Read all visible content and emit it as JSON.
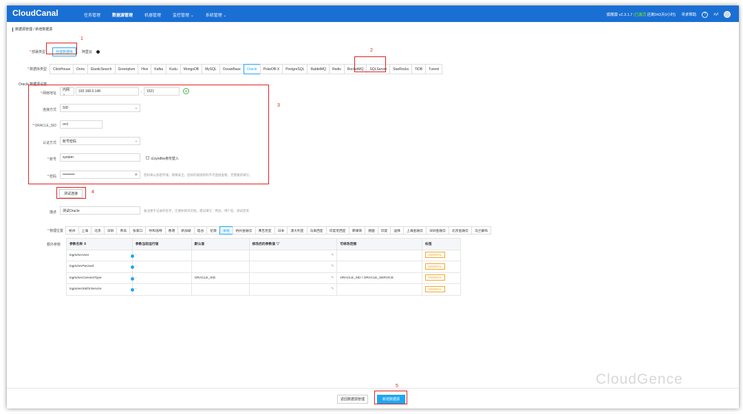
{
  "header": {
    "logo": "CloudCanal",
    "nav": [
      "任务管理",
      "数据源管理",
      "机器管理",
      "监控管理 ⌄",
      "系统管理 ⌄"
    ],
    "version": "旗舰版 v2.3.1.7",
    "status": "(已激活",
    "trial": "还剩343天0小时)",
    "help": "寻求帮助",
    "help_icon": "?",
    "user": "zyl"
  },
  "breadcrumb": [
    "数据源管理",
    "新增数据源"
  ],
  "form": {
    "deploy_label": "部署类型",
    "deploy_options": [
      "自建数据库",
      "阿里云"
    ],
    "dbtype_label": "数据库类型",
    "db_types": [
      "ClickHouse",
      "Doris",
      "ElasticSearch",
      "Greenplum",
      "Hive",
      "Kafka",
      "Kudu",
      "MongoDB",
      "MySQL",
      "OceanBase",
      "Oracle",
      "PolarDB-X",
      "PostgreSQL",
      "RabbitMQ",
      "Redis",
      "RocketMQ",
      "SQLServer",
      "StarRocks",
      "TiDB",
      "Tunnel"
    ],
    "selected_db": "Oracle",
    "section_title": "Oracle 数据源设置",
    "network_label": "网络地址",
    "network_type": "内网 ⌄",
    "host": "192.168.0.148",
    "port": "1521",
    "conn_label": "连接方式",
    "conn_value": "SID",
    "sid_label": "ORACLE_SID",
    "sid_value": "orcl",
    "auth_label": "认证方式",
    "auth_value": "账号密码",
    "account_label": "账号",
    "account_value": "system",
    "sysdba": "以sysdba身份登入",
    "password_label": "密码",
    "password_value": "••••••••••",
    "password_hint": "密码将以加密存储，保障安全。后续的链接新的不可直接查看，无需重新填写。",
    "test_btn": "测试连接",
    "desc_label": "描述",
    "desc_value": "测试Oracle",
    "desc_hint": "备注便于记录的名字，方便你辨识识别。建议填写：用途、用户名、测试还等",
    "region_label": "物理位置",
    "regions": [
      "杭州",
      "上海",
      "北京",
      "深圳",
      "青岛",
      "张家口",
      "呼和浩特",
      "香港",
      "新加坡",
      "硅谷",
      "伦敦",
      "本地",
      "杭州金融云",
      "弗吉尼亚",
      "日本",
      "澳大利亚",
      "马来西亚",
      "印度尼西亚",
      "菲律宾",
      "德国",
      "印度",
      "迪拜",
      "上海金融云",
      "深圳金融云",
      "北京金融云",
      "乌兰察布"
    ],
    "selected_region": "本地",
    "extra_label": "额外参数"
  },
  "params_table": {
    "headers": [
      "参数名称 ⇕",
      "参数当前运行值",
      "默认值",
      "修改后的参数值 ▽",
      "可修改范围",
      "标签"
    ],
    "rows": [
      {
        "name": "logminerUser",
        "current": "-",
        "default": "",
        "range": "",
        "tag": "GENERAL"
      },
      {
        "name": "logminerPasswd",
        "current": "-",
        "default": "",
        "range": "",
        "tag": "GENERAL"
      },
      {
        "name": "logminerConnectType",
        "current": "-",
        "default": "ORACLE_SID",
        "range": "ORACLE_SID / ORACLE_SERVICE",
        "tag": "GENERAL"
      },
      {
        "name": "logminerSidOrService",
        "current": "-",
        "default": "",
        "range": "",
        "tag": "GENERAL"
      }
    ]
  },
  "footer": {
    "back_btn": "返回数据源管理",
    "submit_btn": "新增数据源"
  },
  "annotations": [
    "1",
    "2",
    "3",
    "4",
    "5"
  ],
  "watermark": "CloudGence",
  "colors": {
    "topbar": "#1a6fd4",
    "accent": "#1ea7f2",
    "annotation": "#e02020",
    "tag": "#f5a623"
  }
}
